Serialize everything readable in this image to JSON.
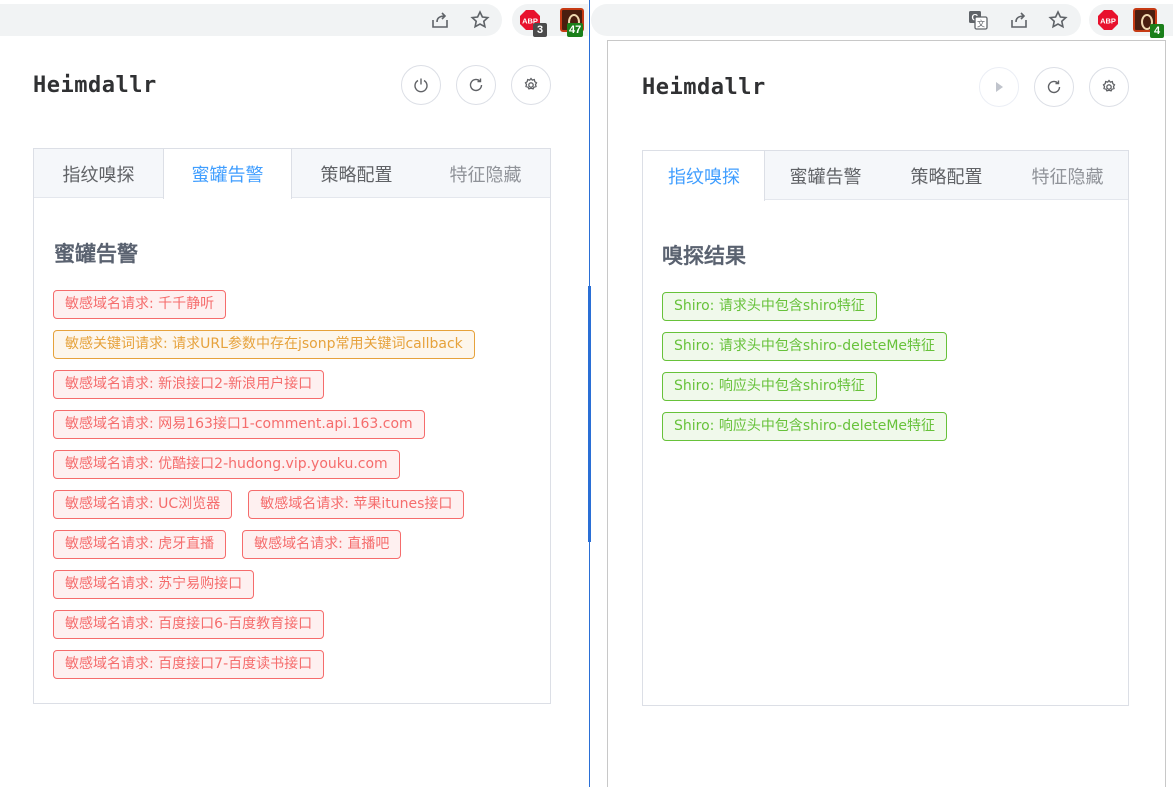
{
  "left_window": {
    "toolbar": {
      "icons": [
        "share-icon",
        "star-icon"
      ],
      "extensions": [
        {
          "name": "adblock-plus",
          "label": "ABP",
          "badge": "3",
          "badge_color": "#4b4b4b"
        },
        {
          "name": "heimdallr-extension",
          "badge": "47",
          "badge_color": "#1a7f1a"
        }
      ]
    },
    "popup": {
      "title": "Heimdallr",
      "buttons": [
        "power-icon",
        "refresh-icon",
        "settings-icon"
      ],
      "tabs": [
        {
          "label": "指纹嗅探",
          "active": false
        },
        {
          "label": "蜜罐告警",
          "active": true
        },
        {
          "label": "策略配置",
          "active": false
        },
        {
          "label": "特征隐藏",
          "active": false,
          "muted": true
        }
      ],
      "section_title": "蜜罐告警",
      "tag_rows": [
        [
          {
            "text": "敏感域名请求: 千千静听",
            "type": "danger"
          }
        ],
        [
          {
            "text": "敏感关键词请求: 请求URL参数中存在jsonp常用关键词callback",
            "type": "warning"
          }
        ],
        [
          {
            "text": "敏感域名请求: 新浪接口2-新浪用户接口",
            "type": "danger"
          }
        ],
        [
          {
            "text": "敏感域名请求: 网易163接口1-comment.api.163.com",
            "type": "danger"
          }
        ],
        [
          {
            "text": "敏感域名请求: 优酷接口2-hudong.vip.youku.com",
            "type": "danger"
          }
        ],
        [
          {
            "text": "敏感域名请求: UC浏览器",
            "type": "danger"
          },
          {
            "text": "敏感域名请求: 苹果itunes接口",
            "type": "danger"
          }
        ],
        [
          {
            "text": "敏感域名请求: 虎牙直播",
            "type": "danger"
          },
          {
            "text": "敏感域名请求: 直播吧",
            "type": "danger"
          }
        ],
        [
          {
            "text": "敏感域名请求: 苏宁易购接口",
            "type": "danger"
          }
        ],
        [
          {
            "text": "敏感域名请求: 百度接口6-百度教育接口",
            "type": "danger"
          }
        ],
        [
          {
            "text": "敏感域名请求: 百度接口7-百度读书接口",
            "type": "danger"
          }
        ]
      ]
    }
  },
  "right_window": {
    "toolbar": {
      "icons": [
        "translate-icon",
        "share-icon",
        "star-icon"
      ],
      "extensions": [
        {
          "name": "adblock-plus",
          "label": "ABP"
        },
        {
          "name": "heimdallr-extension",
          "badge": "4",
          "badge_color": "#1a7f1a"
        }
      ]
    },
    "popup": {
      "title": "Heimdallr",
      "buttons": [
        "play-icon",
        "refresh-icon",
        "settings-icon"
      ],
      "tabs": [
        {
          "label": "指纹嗅探",
          "active": true
        },
        {
          "label": "蜜罐告警",
          "active": false
        },
        {
          "label": "策略配置",
          "active": false
        },
        {
          "label": "特征隐藏",
          "active": false,
          "muted": true
        }
      ],
      "section_title": "嗅探结果",
      "tag_rows": [
        [
          {
            "text": "Shiro: 请求头中包含shiro特征",
            "type": "success"
          }
        ],
        [
          {
            "text": "Shiro: 请求头中包含shiro-deleteMe特征",
            "type": "success"
          }
        ],
        [
          {
            "text": "Shiro: 响应头中包含shiro特征",
            "type": "success"
          }
        ],
        [
          {
            "text": "Shiro: 响应头中包含shiro-deleteMe特征",
            "type": "success"
          }
        ]
      ]
    }
  }
}
